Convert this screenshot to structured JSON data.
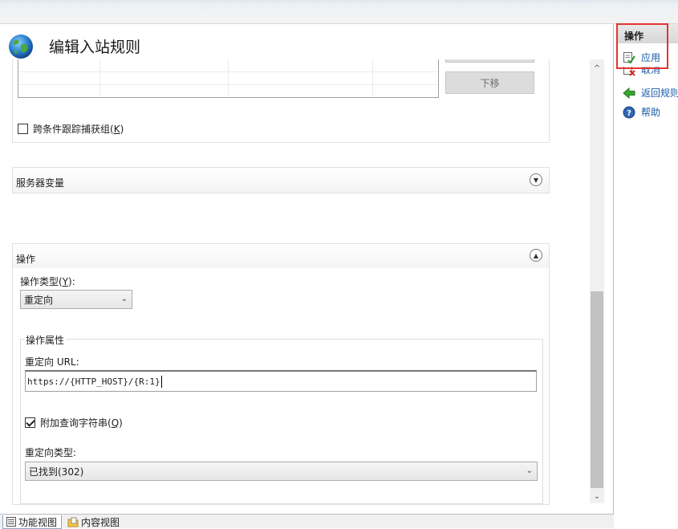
{
  "page": {
    "title": "编辑入站规则"
  },
  "conditions": {
    "move_down_label": "下移",
    "track_groups_label": "跨条件跟踪捕获组(",
    "track_groups_key": "K",
    "track_groups_checked": false
  },
  "server_vars": {
    "title": "服务器变量",
    "expanded": false
  },
  "action": {
    "title": "操作",
    "expanded": true,
    "type_label": "操作类型(",
    "type_key": "Y",
    "type_value": "重定向",
    "props_title": "操作属性",
    "redirect_url_label": "重定向 URL:",
    "redirect_url_value": "https://{HTTP_HOST}/{R:1}",
    "append_query_label": "附加查询字符串(",
    "append_query_key": "Q",
    "append_query_checked": true,
    "redirect_type_label": "重定向类型:",
    "redirect_type_value": "已找到(302)"
  },
  "tabs": [
    {
      "label": "功能视图",
      "active": true
    },
    {
      "label": "内容视图",
      "active": false
    }
  ],
  "actions_pane": {
    "title": "操作",
    "items": [
      {
        "label": "应用",
        "icon": "apply-icon"
      },
      {
        "label": "取消",
        "icon": "cancel-icon"
      },
      {
        "label": "返回规则",
        "icon": "back-arrow-icon"
      },
      {
        "label": "帮助",
        "icon": "help-icon"
      }
    ]
  },
  "colors": {
    "link": "#1a5aa6",
    "highlight": "#e53333",
    "back_arrow": "#3aa531"
  }
}
